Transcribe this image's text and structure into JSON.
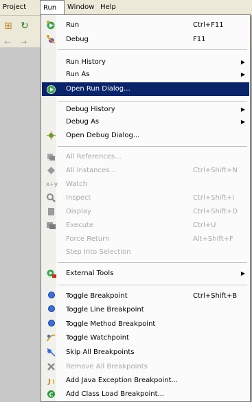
{
  "menubar": {
    "items": [
      "Project",
      "Run",
      "Window",
      "Help"
    ]
  },
  "menu": {
    "items": [
      {
        "label": "Run",
        "shortcut": "Ctrl+F11",
        "icon": "run-icon",
        "enabled": true
      },
      {
        "label": "Debug",
        "shortcut": "F11",
        "icon": "debug-icon",
        "enabled": true
      },
      {
        "label": "Run History",
        "submenu": true,
        "enabled": true
      },
      {
        "label": "Run As",
        "submenu": true,
        "enabled": true
      },
      {
        "label": "Open Run Dialog...",
        "icon": "run-dialog-icon",
        "enabled": true,
        "highlighted": true
      },
      {
        "label": "Debug History",
        "submenu": true,
        "enabled": true
      },
      {
        "label": "Debug As",
        "submenu": true,
        "enabled": true
      },
      {
        "label": "Open Debug Dialog...",
        "icon": "debug-dialog-icon",
        "enabled": true
      },
      {
        "label": "All References...",
        "icon": "references-icon",
        "enabled": false
      },
      {
        "label": "All Instances...",
        "shortcut": "Ctrl+Shift+N",
        "icon": "instances-icon",
        "enabled": false
      },
      {
        "label": "Watch",
        "icon": "watch-icon",
        "enabled": false
      },
      {
        "label": "Inspect",
        "shortcut": "Ctrl+Shift+I",
        "icon": "inspect-icon",
        "enabled": false
      },
      {
        "label": "Display",
        "shortcut": "Ctrl+Shift+D",
        "icon": "display-icon",
        "enabled": false
      },
      {
        "label": "Execute",
        "shortcut": "Ctrl+U",
        "icon": "execute-icon",
        "enabled": false
      },
      {
        "label": "Force Return",
        "shortcut": "Alt+Shift+F",
        "enabled": false
      },
      {
        "label": "Step Into Selection",
        "enabled": false
      },
      {
        "label": "External Tools",
        "submenu": true,
        "icon": "external-tools-icon",
        "enabled": true
      },
      {
        "label": "Toggle Breakpoint",
        "shortcut": "Ctrl+Shift+B",
        "icon": "breakpoint-icon",
        "enabled": true
      },
      {
        "label": "Toggle Line Breakpoint",
        "icon": "breakpoint-icon",
        "enabled": true
      },
      {
        "label": "Toggle Method Breakpoint",
        "icon": "breakpoint-icon",
        "enabled": true
      },
      {
        "label": "Toggle Watchpoint",
        "icon": "watchpoint-icon",
        "enabled": true
      },
      {
        "label": "Skip All Breakpoints",
        "icon": "skip-breakpoints-icon",
        "enabled": true
      },
      {
        "label": "Remove All Breakpoints",
        "icon": "remove-breakpoints-icon",
        "enabled": false
      },
      {
        "label": "Add Java Exception Breakpoint...",
        "icon": "exception-breakpoint-icon",
        "enabled": true
      },
      {
        "label": "Add Class Load Breakpoint...",
        "icon": "class-load-breakpoint-icon",
        "enabled": true
      }
    ]
  },
  "colors": {
    "highlight": "#0a246a",
    "disabled_text": "#a8a8a8",
    "breakpoint_blue": "#3a6fd8",
    "run_green": "#2a9a3a"
  }
}
